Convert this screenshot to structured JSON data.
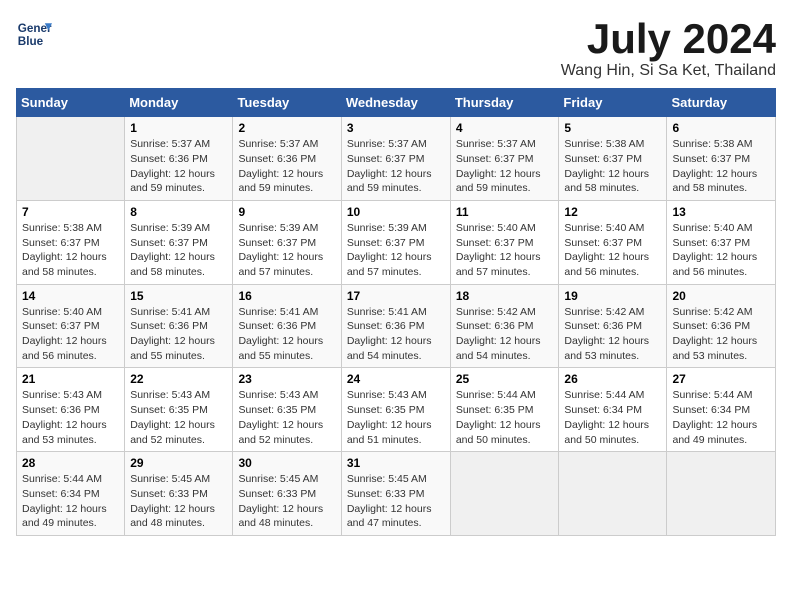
{
  "logo": {
    "line1": "General",
    "line2": "Blue"
  },
  "title": {
    "month_year": "July 2024",
    "location": "Wang Hin, Si Sa Ket, Thailand"
  },
  "headers": [
    "Sunday",
    "Monday",
    "Tuesday",
    "Wednesday",
    "Thursday",
    "Friday",
    "Saturday"
  ],
  "weeks": [
    [
      {
        "day": "",
        "sunrise": "",
        "sunset": "",
        "daylight": "",
        "empty": true
      },
      {
        "day": "1",
        "sunrise": "Sunrise: 5:37 AM",
        "sunset": "Sunset: 6:36 PM",
        "daylight": "Daylight: 12 hours and 59 minutes."
      },
      {
        "day": "2",
        "sunrise": "Sunrise: 5:37 AM",
        "sunset": "Sunset: 6:36 PM",
        "daylight": "Daylight: 12 hours and 59 minutes."
      },
      {
        "day": "3",
        "sunrise": "Sunrise: 5:37 AM",
        "sunset": "Sunset: 6:37 PM",
        "daylight": "Daylight: 12 hours and 59 minutes."
      },
      {
        "day": "4",
        "sunrise": "Sunrise: 5:37 AM",
        "sunset": "Sunset: 6:37 PM",
        "daylight": "Daylight: 12 hours and 59 minutes."
      },
      {
        "day": "5",
        "sunrise": "Sunrise: 5:38 AM",
        "sunset": "Sunset: 6:37 PM",
        "daylight": "Daylight: 12 hours and 58 minutes."
      },
      {
        "day": "6",
        "sunrise": "Sunrise: 5:38 AM",
        "sunset": "Sunset: 6:37 PM",
        "daylight": "Daylight: 12 hours and 58 minutes."
      }
    ],
    [
      {
        "day": "7",
        "sunrise": "Sunrise: 5:38 AM",
        "sunset": "Sunset: 6:37 PM",
        "daylight": "Daylight: 12 hours and 58 minutes."
      },
      {
        "day": "8",
        "sunrise": "Sunrise: 5:39 AM",
        "sunset": "Sunset: 6:37 PM",
        "daylight": "Daylight: 12 hours and 58 minutes."
      },
      {
        "day": "9",
        "sunrise": "Sunrise: 5:39 AM",
        "sunset": "Sunset: 6:37 PM",
        "daylight": "Daylight: 12 hours and 57 minutes."
      },
      {
        "day": "10",
        "sunrise": "Sunrise: 5:39 AM",
        "sunset": "Sunset: 6:37 PM",
        "daylight": "Daylight: 12 hours and 57 minutes."
      },
      {
        "day": "11",
        "sunrise": "Sunrise: 5:40 AM",
        "sunset": "Sunset: 6:37 PM",
        "daylight": "Daylight: 12 hours and 57 minutes."
      },
      {
        "day": "12",
        "sunrise": "Sunrise: 5:40 AM",
        "sunset": "Sunset: 6:37 PM",
        "daylight": "Daylight: 12 hours and 56 minutes."
      },
      {
        "day": "13",
        "sunrise": "Sunrise: 5:40 AM",
        "sunset": "Sunset: 6:37 PM",
        "daylight": "Daylight: 12 hours and 56 minutes."
      }
    ],
    [
      {
        "day": "14",
        "sunrise": "Sunrise: 5:40 AM",
        "sunset": "Sunset: 6:37 PM",
        "daylight": "Daylight: 12 hours and 56 minutes."
      },
      {
        "day": "15",
        "sunrise": "Sunrise: 5:41 AM",
        "sunset": "Sunset: 6:36 PM",
        "daylight": "Daylight: 12 hours and 55 minutes."
      },
      {
        "day": "16",
        "sunrise": "Sunrise: 5:41 AM",
        "sunset": "Sunset: 6:36 PM",
        "daylight": "Daylight: 12 hours and 55 minutes."
      },
      {
        "day": "17",
        "sunrise": "Sunrise: 5:41 AM",
        "sunset": "Sunset: 6:36 PM",
        "daylight": "Daylight: 12 hours and 54 minutes."
      },
      {
        "day": "18",
        "sunrise": "Sunrise: 5:42 AM",
        "sunset": "Sunset: 6:36 PM",
        "daylight": "Daylight: 12 hours and 54 minutes."
      },
      {
        "day": "19",
        "sunrise": "Sunrise: 5:42 AM",
        "sunset": "Sunset: 6:36 PM",
        "daylight": "Daylight: 12 hours and 53 minutes."
      },
      {
        "day": "20",
        "sunrise": "Sunrise: 5:42 AM",
        "sunset": "Sunset: 6:36 PM",
        "daylight": "Daylight: 12 hours and 53 minutes."
      }
    ],
    [
      {
        "day": "21",
        "sunrise": "Sunrise: 5:43 AM",
        "sunset": "Sunset: 6:36 PM",
        "daylight": "Daylight: 12 hours and 53 minutes."
      },
      {
        "day": "22",
        "sunrise": "Sunrise: 5:43 AM",
        "sunset": "Sunset: 6:35 PM",
        "daylight": "Daylight: 12 hours and 52 minutes."
      },
      {
        "day": "23",
        "sunrise": "Sunrise: 5:43 AM",
        "sunset": "Sunset: 6:35 PM",
        "daylight": "Daylight: 12 hours and 52 minutes."
      },
      {
        "day": "24",
        "sunrise": "Sunrise: 5:43 AM",
        "sunset": "Sunset: 6:35 PM",
        "daylight": "Daylight: 12 hours and 51 minutes."
      },
      {
        "day": "25",
        "sunrise": "Sunrise: 5:44 AM",
        "sunset": "Sunset: 6:35 PM",
        "daylight": "Daylight: 12 hours and 50 minutes."
      },
      {
        "day": "26",
        "sunrise": "Sunrise: 5:44 AM",
        "sunset": "Sunset: 6:34 PM",
        "daylight": "Daylight: 12 hours and 50 minutes."
      },
      {
        "day": "27",
        "sunrise": "Sunrise: 5:44 AM",
        "sunset": "Sunset: 6:34 PM",
        "daylight": "Daylight: 12 hours and 49 minutes."
      }
    ],
    [
      {
        "day": "28",
        "sunrise": "Sunrise: 5:44 AM",
        "sunset": "Sunset: 6:34 PM",
        "daylight": "Daylight: 12 hours and 49 minutes."
      },
      {
        "day": "29",
        "sunrise": "Sunrise: 5:45 AM",
        "sunset": "Sunset: 6:33 PM",
        "daylight": "Daylight: 12 hours and 48 minutes."
      },
      {
        "day": "30",
        "sunrise": "Sunrise: 5:45 AM",
        "sunset": "Sunset: 6:33 PM",
        "daylight": "Daylight: 12 hours and 48 minutes."
      },
      {
        "day": "31",
        "sunrise": "Sunrise: 5:45 AM",
        "sunset": "Sunset: 6:33 PM",
        "daylight": "Daylight: 12 hours and 47 minutes."
      },
      {
        "day": "",
        "sunrise": "",
        "sunset": "",
        "daylight": "",
        "empty": true
      },
      {
        "day": "",
        "sunrise": "",
        "sunset": "",
        "daylight": "",
        "empty": true
      },
      {
        "day": "",
        "sunrise": "",
        "sunset": "",
        "daylight": "",
        "empty": true
      }
    ]
  ]
}
